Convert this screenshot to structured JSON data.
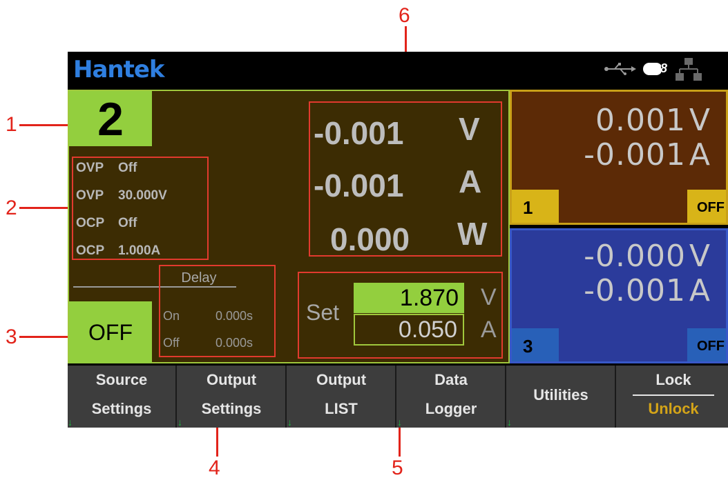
{
  "callouts": [
    "1",
    "2",
    "3",
    "4",
    "5",
    "6"
  ],
  "brand": "Hantek",
  "status_icons": [
    "usb-icon",
    "toggle-icon",
    "network-icon"
  ],
  "status_toggle_text": "8",
  "channel2": {
    "number": "2",
    "protection": [
      {
        "label": "OVP",
        "value": "Off"
      },
      {
        "label": "OVP",
        "value": "30.000V"
      },
      {
        "label": "OCP",
        "value": "Off"
      },
      {
        "label": "OCP",
        "value": "1.000A"
      }
    ],
    "delay": {
      "title": "Delay",
      "on_label": "On",
      "on_value": "0.000s",
      "off_label": "Off",
      "off_value": "0.000s"
    },
    "output_state": "OFF",
    "measured": [
      {
        "value": "-0.001",
        "unit": "V"
      },
      {
        "value": "-0.001",
        "unit": "A"
      },
      {
        "value": "0.000",
        "unit": "W"
      }
    ],
    "set": {
      "label": "Set",
      "voltage": "1.870",
      "voltage_unit": "V",
      "current": "0.050",
      "current_unit": "A"
    }
  },
  "channel1": {
    "number": "1",
    "voltage": "0.001",
    "voltage_unit": "V",
    "current": "-0.001",
    "current_unit": "A",
    "state": "OFF"
  },
  "channel3": {
    "number": "3",
    "voltage": "-0.000",
    "voltage_unit": "V",
    "current": "-0.001",
    "current_unit": "A",
    "state": "OFF"
  },
  "softkeys": [
    {
      "line1": "Source",
      "line2": "Settings"
    },
    {
      "line1": "Output",
      "line2": "Settings"
    },
    {
      "line1": "Output",
      "line2": "LIST"
    },
    {
      "line1": "Data",
      "line2": "Logger"
    },
    {
      "line1": "Utilities",
      "line2": ""
    },
    {
      "line1": "Lock",
      "line2": "Unlock"
    }
  ],
  "colors": {
    "accent_green": "#93cf3e",
    "ch2_bg": "#3c2c03",
    "ch1_bg": "#5c2a06",
    "ch1_tag": "#d8b418",
    "ch3_bg": "#2b3b9b",
    "ch3_tag": "#2860b8",
    "callout_red": "#e2231a",
    "unlock_yellow": "#d4a418",
    "brand_blue": "#2f7fe0"
  }
}
